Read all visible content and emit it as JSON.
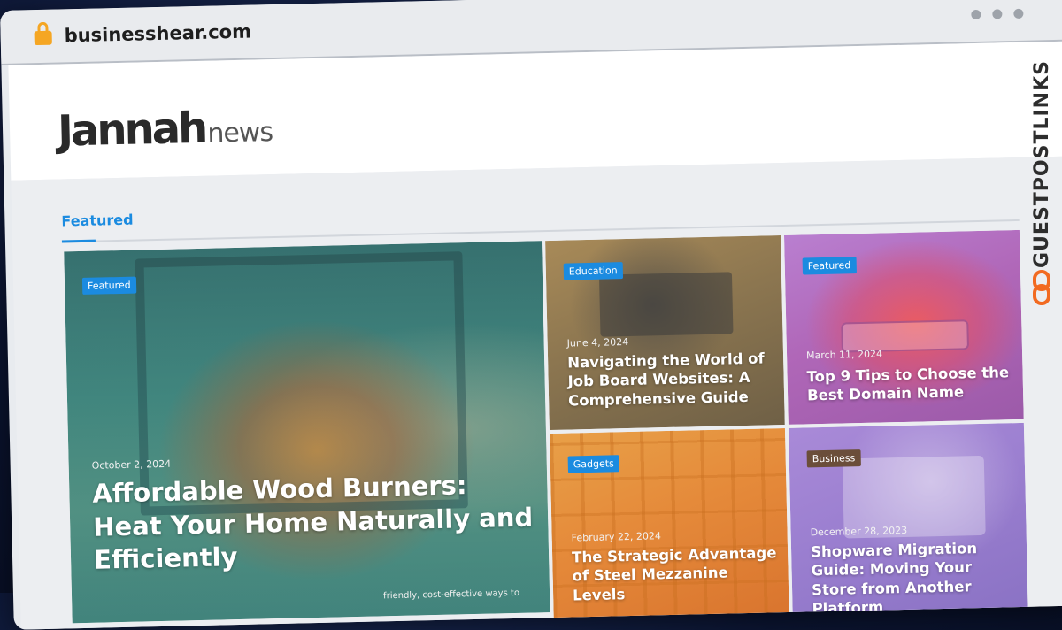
{
  "browser": {
    "url": "businesshear.com"
  },
  "site": {
    "logo_main": "Jannah",
    "logo_sub": "news"
  },
  "section": {
    "title": "Featured"
  },
  "watermark": {
    "text": "GUESTPOSTLINKS"
  },
  "cards": [
    {
      "badge": "Featured",
      "date": "October 2, 2024",
      "title": "Affordable Wood Burners: Heat Your Home Naturally and Efficiently",
      "excerpt": "friendly, cost-effective ways to"
    },
    {
      "badge": "Education",
      "date": "June 4, 2024",
      "title": "Navigating the World of Job Board Websites: A Comprehensive Guide"
    },
    {
      "badge": "Featured",
      "date": "March 11, 2024",
      "title": "Top 9 Tips to Choose the Best Domain Name"
    },
    {
      "badge": "Gadgets",
      "date": "February 22, 2024",
      "title": "The Strategic Advantage of Steel Mezzanine Levels"
    },
    {
      "badge": "Business",
      "date": "December 28, 2023",
      "title": "Shopware Migration Guide: Moving Your Store from Another Platform"
    }
  ],
  "colors": {
    "accent": "#1b8be0",
    "business_badge": "#6b4e3a"
  }
}
